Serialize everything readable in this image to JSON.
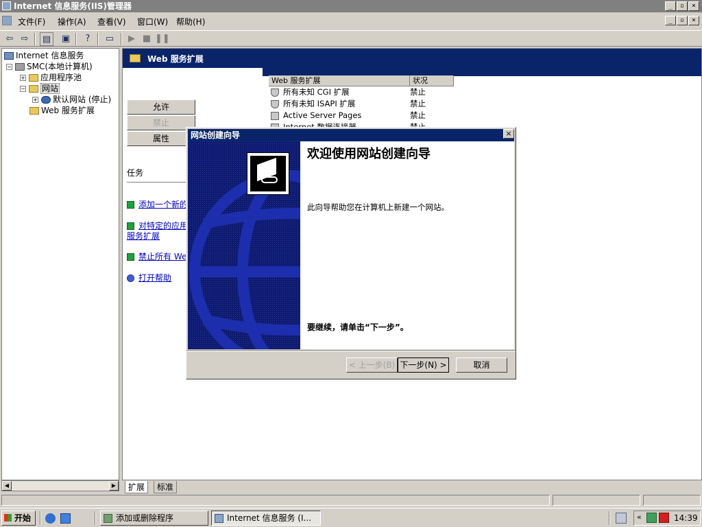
{
  "window": {
    "title": "Internet 信息服务(IIS)管理器"
  },
  "menu": [
    "文件(F)",
    "操作(A)",
    "查看(V)",
    "窗口(W)",
    "帮助(H)"
  ],
  "tree": {
    "root": "Internet 信息服务",
    "computer": "SMC(本地计算机)",
    "app_pools": "应用程序池",
    "websites": "网站",
    "default_site": "默认网站 (停止)",
    "web_ext": "Web 服务扩展"
  },
  "right_panel": {
    "header": "Web 服务扩展",
    "buttons": {
      "allow": "允许",
      "deny": "禁止",
      "properties": "属性"
    },
    "tasks_label": "任务",
    "tasks": [
      "添加一个新的",
      "对特定的应用",
      "服务扩展",
      "禁止所有 Wel",
      "打开帮助"
    ],
    "columns": [
      "Web 服务扩展",
      "状况"
    ],
    "rows": [
      {
        "name": "所有未知 CGI 扩展",
        "status": "禁止"
      },
      {
        "name": "所有未知 ISAPI 扩展",
        "status": "禁止"
      },
      {
        "name": "Active Server Pages",
        "status": "禁止"
      },
      {
        "name": "Internet 数据连接器",
        "status": "禁止"
      }
    ],
    "tabs": [
      "扩展",
      "标准"
    ]
  },
  "dialog": {
    "title": "网站创建向导",
    "heading": "欢迎使用网站创建向导",
    "description": "此向导帮助您在计算机上新建一个网站。",
    "continue_text": "要继续，请单击“下一步”。",
    "back": "< 上一步(B)",
    "next": "下一步(N) >",
    "cancel": "取消"
  },
  "taskbar": {
    "start": "开始",
    "items": [
      "添加或删除程序",
      "Internet 信息服务 (I..."
    ],
    "clock": "14:39"
  },
  "colors": {
    "title_active": "#0a246a",
    "title_inactive": "#808080",
    "face": "#d4d0c8"
  }
}
